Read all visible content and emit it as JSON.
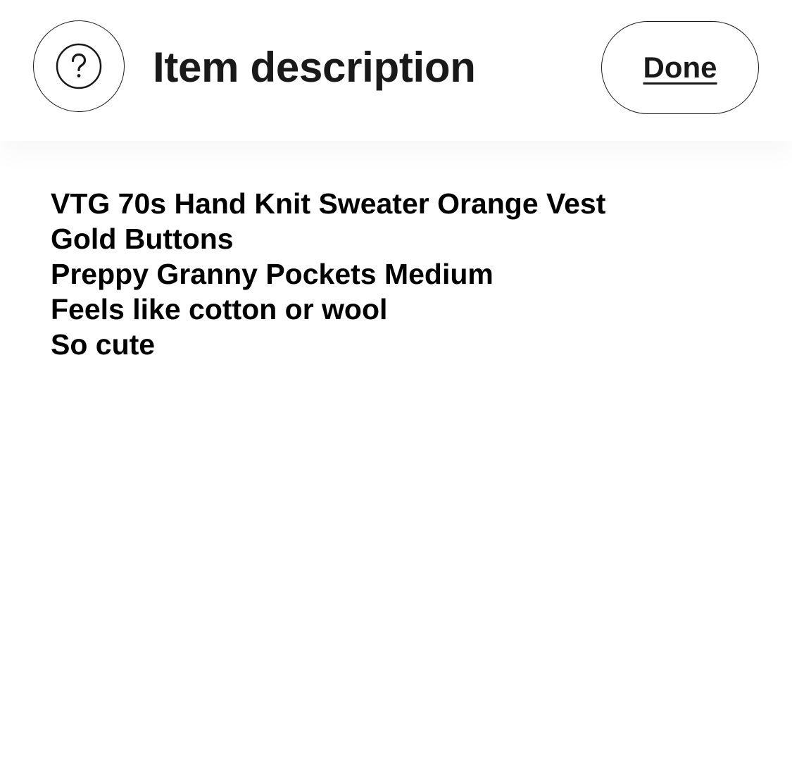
{
  "header": {
    "help_icon": "question-mark-circle-icon",
    "title": "Item description",
    "done_label": "Done"
  },
  "description": {
    "lines": [
      "VTG 70s Hand Knit Sweater Orange Vest",
      "Gold Buttons",
      "Preppy Granny Pockets Medium",
      "Feels like cotton or wool",
      "So cute"
    ]
  },
  "colors": {
    "text": "#191919",
    "background": "#ffffff"
  }
}
